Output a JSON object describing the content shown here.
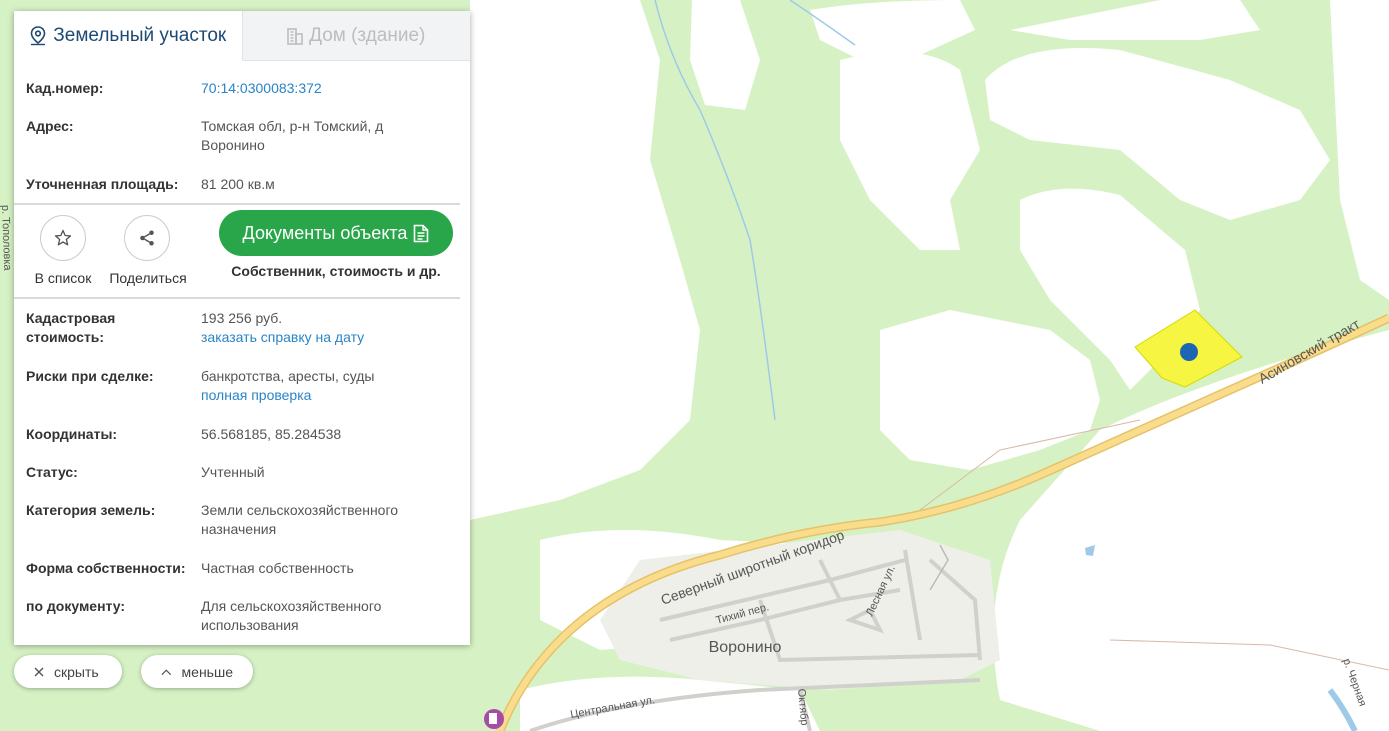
{
  "tabs": {
    "land": "Земельный участок",
    "building": "Дом (здание)"
  },
  "details_top": [
    {
      "label": "Кад.номер:",
      "value": "70:14:0300083:372",
      "link": ""
    },
    {
      "label": "Адрес:",
      "value": "Томская обл, р-н Томский, д Воронино",
      "link": ""
    },
    {
      "label": "Уточненная площадь:",
      "value": "81 200 кв.м",
      "link": ""
    }
  ],
  "actions": {
    "to_list": "В список",
    "share": "Поделиться",
    "documents": "Документы объекта",
    "documents_sub": "Собственник, стоимость и др."
  },
  "details_bottom": [
    {
      "label": "Кадастровая стоимость:",
      "value": "193 256 руб.",
      "link": "заказать справку на дату"
    },
    {
      "label": "Риски при сделке:",
      "value": "банкротства, аресты, суды",
      "link": "полная проверка"
    },
    {
      "label": "Координаты:",
      "value": "56.568185, 85.284538",
      "link": ""
    },
    {
      "label": "Статус:",
      "value": "Учтенный",
      "link": ""
    },
    {
      "label": "Категория земель:",
      "value": "Земли сельскохозяйственного назначения",
      "link": ""
    },
    {
      "label": "Форма собственности:",
      "value": "Частная собственность",
      "link": ""
    },
    {
      "label": "по документу:",
      "value": "Для сельскохозяйственного использования",
      "link": ""
    }
  ],
  "controls": {
    "hide": "скрыть",
    "less": "меньше"
  },
  "map_labels": {
    "village": "Воронино",
    "road_north": "Северный широтный коридор",
    "road_asino": "Асиновский тракт",
    "street_tikhiy": "Тихий пер.",
    "street_lesnaya": "Лесная ул.",
    "street_central": "Центральная ул.",
    "street_oktyabr": "Октябр",
    "river_topolovka": "р. Тополовка",
    "river_chernaya": "р. Черная"
  },
  "colors": {
    "forest": "#d6f2c4",
    "field": "#ffffff",
    "parcel": "#f5f542",
    "marker": "#1c66b4",
    "road": "#f7d87a",
    "accent_link": "#2a84c6",
    "doc_button": "#2aa64a"
  }
}
